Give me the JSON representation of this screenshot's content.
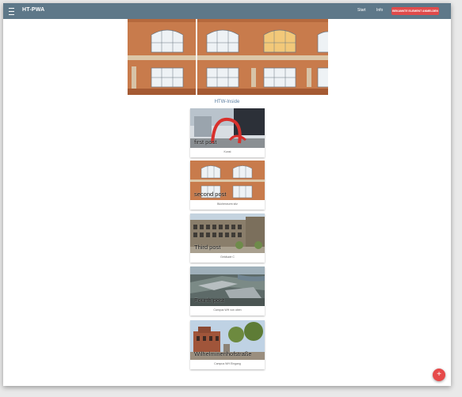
{
  "appbar": {
    "title": "HT-PWA",
    "nav": [
      "Start",
      "Info"
    ],
    "cta_label": "BEKANNTE ELEMENT ANMELDEN",
    "menu_icon": "hamburger-menu-icon"
  },
  "hero": {
    "image": "brick-building-facade-photo"
  },
  "section_title": "HTW-Inside",
  "posts": [
    {
      "title": "first post",
      "caption": "Kunst",
      "image": "red-sculpture-photo"
    },
    {
      "title": "second post",
      "caption": "Bücherwurm sitz",
      "image": "brick-facade-photo"
    },
    {
      "title": "Third post",
      "caption": "Gebäude C",
      "image": "campus-building-photo"
    },
    {
      "title": "Fourth post",
      "caption": "Campus WH von oben",
      "image": "campus-aerial-photo"
    },
    {
      "title": "Wilhelminenhofstraße",
      "caption": "Campus WH Eingang",
      "image": "campus-entrance-photo"
    }
  ],
  "fab": {
    "label": "+",
    "icon": "plus-icon",
    "color": "#e64a4a"
  },
  "colors": {
    "appbar": "#5e7889",
    "accent": "#e04b4b"
  }
}
